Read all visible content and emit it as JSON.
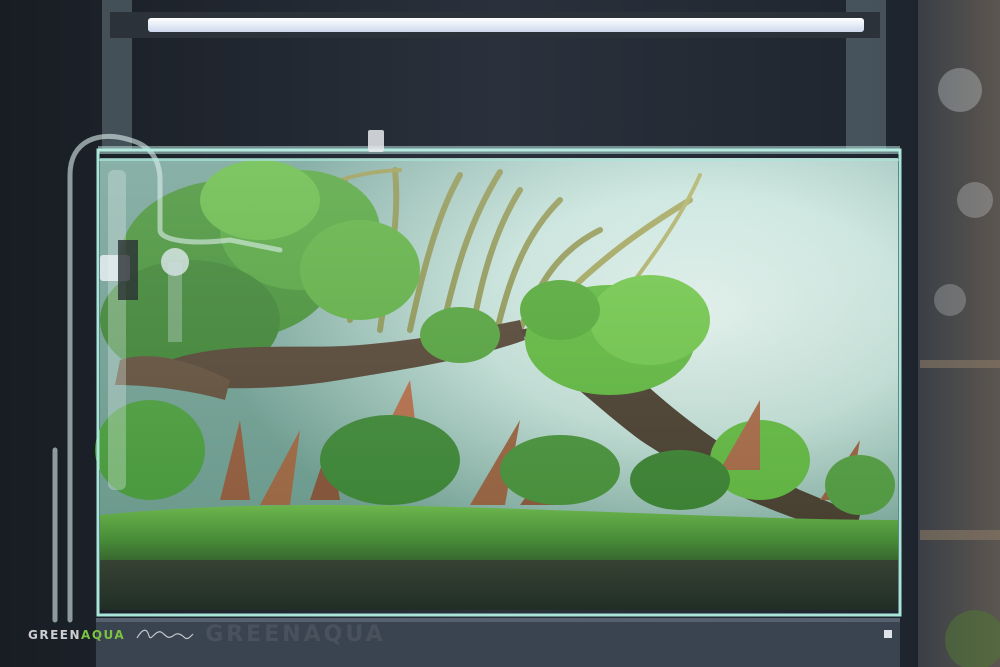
{
  "watermark": {
    "brand_part1": "GREEN",
    "brand_part2": "AQUA",
    "ghost_text": "GREENAQUA"
  },
  "colors": {
    "backdrop": "#20262f",
    "light_bar": "#f4f7ff",
    "glass_edge": "#a8e6da",
    "carpet": "#4f9a2a",
    "stem_plants": "#3f8f25",
    "red_plants": "#9b4a2a",
    "hardscape_wood": "#4a2e1e",
    "tall_grass": "#8c8a3a",
    "moss": "#58b82b",
    "background_glow": "#eaf3f2",
    "cabinet": "#3a4350"
  },
  "icons": [
    "led-light-bar",
    "co2-diffuser",
    "glass-lily-pipe",
    "filter-intake"
  ]
}
